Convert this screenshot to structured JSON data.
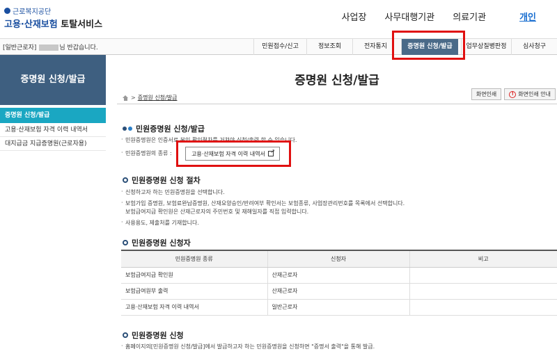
{
  "header": {
    "logo_org": "근로복지공단",
    "logo_service_blue": "고용·산재보험",
    "logo_service_dark": "토탈서비스",
    "nav": [
      "사업장",
      "사무대행기관",
      "의료기관"
    ],
    "nav_active": "개인"
  },
  "subbar": {
    "greeting_prefix": "[일반근로자]",
    "greeting_suffix": "님 반갑습니다.",
    "menu": [
      "민원접수/신고",
      "정보조회",
      "전자통지",
      "증명원 신청/발급",
      "업무상질병판정",
      "심사청구"
    ],
    "menu_active_index": 3
  },
  "sidebar": {
    "title": "증명원 신청/발급",
    "active_item": "증명원 신청/발급",
    "items": [
      "고용·산재보험 자격 이력 내역서",
      "대지급금 지급증명원(근로자용)"
    ]
  },
  "main": {
    "title": "증명원 신청/발급",
    "breadcrumb": "증명원 신청/발급",
    "print_button": "화면인쇄",
    "print_guide_button": "화면인쇄 안내",
    "sec1": {
      "title": "민원증명원 신청/발급",
      "line1": "민원증명원은 인증서로 본인 확인절차를 거쳐야 신청/출력 할 수 있습니다.",
      "line2": "민원증명원의 종류 :",
      "history_button": "고용·산재보험 자격 이력 내역서"
    },
    "sec2": {
      "title": "민원증명원 신청 절차",
      "lines": [
        "신청하고자 하는 민원증명원을 선택합니다.",
        "보험가입 증명원, 보험료완납증명원, 산재요양승인/반려여부 확인서는 보험종류, 사업장관리번호를 목록에서 선택합니다.",
        "보험급여지급 확인원은 산재근로자의 주민번호 및 재해일자를 직접 입력합니다.",
        "사용용도, 제출처를 기재합니다."
      ]
    },
    "sec3": {
      "title": "민원증명원 신청자",
      "headers": [
        "민원증명원 종류",
        "신청자",
        "비고"
      ],
      "rows": [
        [
          "보험급여지급 확인원",
          "산재근로자",
          ""
        ],
        [
          "보험급여원부 출력",
          "산재근로자",
          ""
        ],
        [
          "고용·산재보험 자격 이력 내역서",
          "일반근로자",
          ""
        ]
      ]
    },
    "sec4": {
      "title": "민원증명원 신청",
      "line1": "홈페이지의[민원증명원 신청/발급]에서 발급하고자 하는 민원증명원을 신청하면 \"증명서 출력\"을 통해 발급."
    }
  },
  "colors": {
    "brand_blue": "#1a4fa0",
    "sidebar_header": "#3e5f80",
    "sidebar_active": "#1aa7c2",
    "menu_active": "#4a6a88",
    "highlight": "#e01010"
  }
}
